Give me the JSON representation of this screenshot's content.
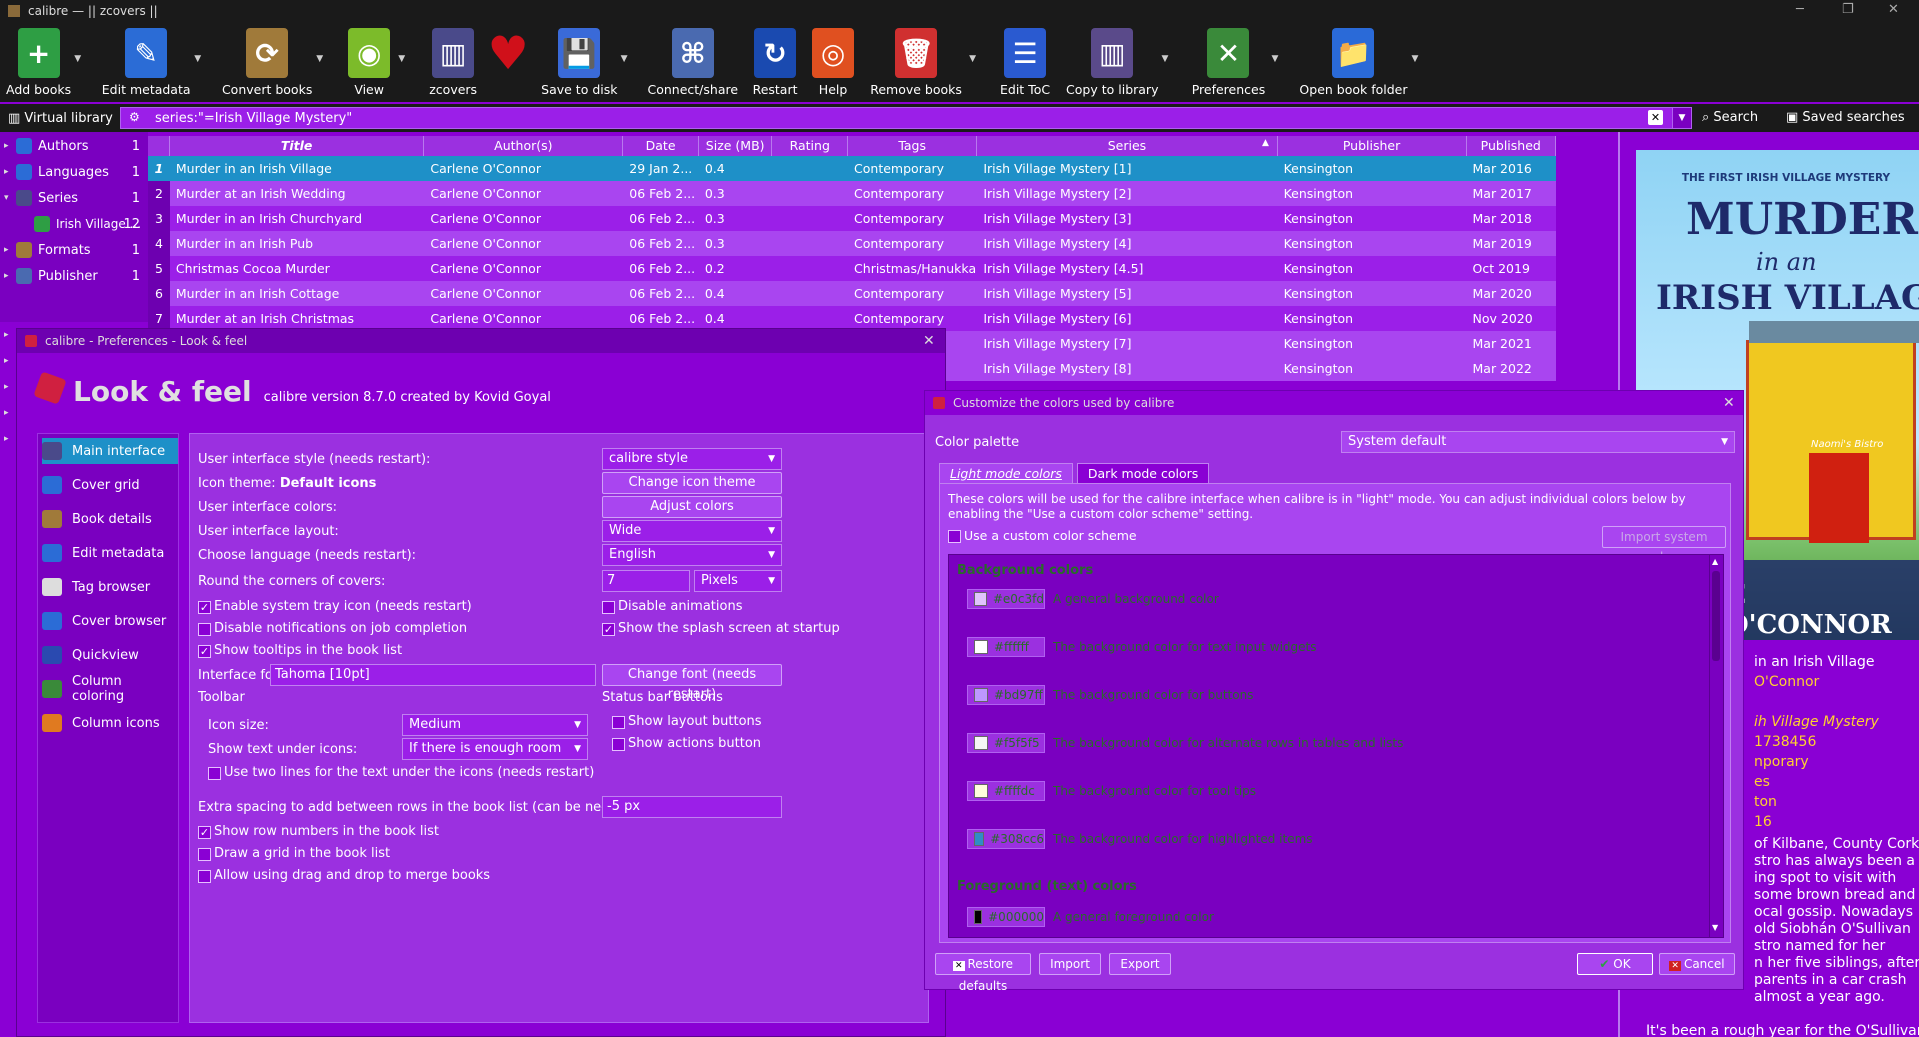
{
  "window": {
    "title": "calibre — || zcovers ||"
  },
  "toolbar": {
    "items": [
      {
        "label": "Add books",
        "icon": "add-books-icon",
        "color": "#2e9e44",
        "glyph": "+",
        "dd": true
      },
      {
        "label": "Edit metadata",
        "icon": "edit-metadata-icon",
        "color": "#2b6cd6",
        "glyph": "✎",
        "dd": true
      },
      {
        "label": "Convert books",
        "icon": "convert-books-icon",
        "color": "#a07a3a",
        "glyph": "⟳",
        "dd": true
      },
      {
        "label": "View",
        "icon": "view-icon",
        "color": "#7cbb2a",
        "glyph": "◉",
        "dd": true
      },
      {
        "label": "zcovers",
        "icon": "library-icon",
        "color": "#4a4a8a",
        "glyph": "▥",
        "dd": false
      },
      {
        "label": "",
        "icon": "heart-icon",
        "color": "#d0101a",
        "glyph": "♥",
        "dd": false
      },
      {
        "label": "Save to disk",
        "icon": "save-icon",
        "color": "#3a6ad8",
        "glyph": "💾",
        "dd": true
      },
      {
        "label": "Connect/share",
        "icon": "connect-share-icon",
        "color": "#4a6ab0",
        "glyph": "⌘",
        "dd": false
      },
      {
        "label": "Restart",
        "icon": "restart-icon",
        "color": "#1a4ab0",
        "glyph": "↻",
        "dd": false
      },
      {
        "label": "Help",
        "icon": "help-icon",
        "color": "#e05020",
        "glyph": "◎",
        "dd": false
      },
      {
        "label": "Remove books",
        "icon": "remove-books-icon",
        "color": "#d03030",
        "glyph": "🗑",
        "dd": true
      },
      {
        "label": "Edit ToC",
        "icon": "edit-toc-icon",
        "color": "#2a5ad0",
        "glyph": "☰",
        "dd": false
      },
      {
        "label": "Copy to library",
        "icon": "copy-library-icon",
        "color": "#5a4a8a",
        "glyph": "▥",
        "dd": true
      },
      {
        "label": "Preferences",
        "icon": "preferences-icon",
        "color": "#3a8a3a",
        "glyph": "✕",
        "dd": true
      },
      {
        "label": "Open book folder",
        "icon": "open-folder-icon",
        "color": "#2a6ad8",
        "glyph": "📁",
        "dd": true
      }
    ]
  },
  "search": {
    "virtual_library": "Virtual library",
    "query": "series:\"=Irish Village Mystery\"",
    "search_label": "Search",
    "saved_label": "Saved searches"
  },
  "tag_browser": {
    "items": [
      {
        "label": "Authors",
        "count": "1",
        "arrow": "▸",
        "icon": "authors-icon",
        "color": "#2b6cd6",
        "indent": false
      },
      {
        "label": "Languages",
        "count": "1",
        "arrow": "▸",
        "icon": "languages-icon",
        "color": "#2b6cd6",
        "indent": false
      },
      {
        "label": "Series",
        "count": "1",
        "arrow": "▾",
        "icon": "series-icon",
        "color": "#4a4a8a",
        "indent": false
      },
      {
        "label": "Irish Village ...",
        "count": "12",
        "arrow": "",
        "icon": "plus-icon",
        "color": "#2e9e44",
        "indent": true
      },
      {
        "label": "Formats",
        "count": "1",
        "arrow": "▸",
        "icon": "formats-icon",
        "color": "#a07a3a",
        "indent": false
      },
      {
        "label": "Publisher",
        "count": "1",
        "arrow": "▸",
        "icon": "publisher-icon",
        "color": "#4a6ab0",
        "indent": false
      }
    ]
  },
  "book_list": {
    "headers": [
      "",
      "Title",
      "Author(s)",
      "Date",
      "Size (MB)",
      "Rating",
      "Tags",
      "Series",
      "Publisher",
      "Published"
    ],
    "rows": [
      [
        "1",
        "Murder in an Irish Village",
        "Carlene O'Connor",
        "29 Jan 2...",
        "0.4",
        "",
        "Contemporary",
        "Irish Village Mystery [1]",
        "Kensington",
        "Mar 2016"
      ],
      [
        "2",
        "Murder at an Irish Wedding",
        "Carlene O'Connor",
        "06 Feb 2...",
        "0.3",
        "",
        "Contemporary",
        "Irish Village Mystery [2]",
        "Kensington",
        "Mar 2017"
      ],
      [
        "3",
        "Murder in an Irish Churchyard",
        "Carlene O'Connor",
        "06 Feb 2...",
        "0.3",
        "",
        "Contemporary",
        "Irish Village Mystery [3]",
        "Kensington",
        "Mar 2018"
      ],
      [
        "4",
        "Murder in an Irish Pub",
        "Carlene O'Connor",
        "06 Feb 2...",
        "0.3",
        "",
        "Contemporary",
        "Irish Village Mystery [4]",
        "Kensington",
        "Mar 2019"
      ],
      [
        "5",
        "Christmas Cocoa Murder",
        "Carlene O'Connor",
        "06 Feb 2...",
        "0.2",
        "",
        "Christmas/Hanukka...",
        "Irish Village Mystery [4.5]",
        "Kensington",
        "Oct 2019"
      ],
      [
        "6",
        "Murder in an Irish Cottage",
        "Carlene O'Connor",
        "06 Feb 2...",
        "0.4",
        "",
        "Contemporary",
        "Irish Village Mystery [5]",
        "Kensington",
        "Mar 2020"
      ],
      [
        "7",
        "Murder at an Irish Christmas",
        "Carlene O'Connor",
        "06 Feb 2...",
        "0.4",
        "",
        "Contemporary",
        "Irish Village Mystery [6]",
        "Kensington",
        "Nov 2020"
      ],
      [
        "8",
        "",
        "",
        "",
        "",
        "",
        "",
        "Irish Village Mystery [7]",
        "Kensington",
        "Mar 2021"
      ],
      [
        "9",
        "",
        "",
        "",
        "",
        "",
        "",
        "Irish Village Mystery [8]",
        "Kensington",
        "Mar 2022"
      ]
    ]
  },
  "cover": {
    "top_line": "THE FIRST IRISH VILLAGE MYSTERY",
    "title1": "MURDER",
    "title2": "in an",
    "title3": "IRISH VILLAGE",
    "author": "E O'CONNOR",
    "sign": "Naomi's Bistro"
  },
  "details": {
    "lines": [
      "in an Irish Village",
      "O'Connor",
      "",
      "ih Village Mystery",
      "1738456",
      "nporary",
      "es",
      "ton",
      "16"
    ],
    "desc": [
      "of Kilbane, County Cork,",
      "stro has always been a",
      "ing spot to visit with",
      "some brown bread and",
      "ocal gossip. Nowadays",
      "old Siobhán O'Sullivan",
      "stro named for her",
      "n her five siblings, after",
      "parents in a car crash",
      "almost a year ago.",
      "",
      "It's been a rough year for the O'Sullivans,"
    ]
  },
  "prefs": {
    "window_title": "calibre - Preferences - Look & feel",
    "header": "Look & feel",
    "version": "calibre version 8.7.0 created by Kovid Goyal",
    "nav": [
      {
        "label": "Main interface",
        "icon": "main-interface-icon",
        "color": "#4a4a8a"
      },
      {
        "label": "Cover grid",
        "icon": "cover-grid-icon",
        "color": "#2b6cd6"
      },
      {
        "label": "Book details",
        "icon": "book-details-icon",
        "color": "#a07a3a"
      },
      {
        "label": "Edit metadata",
        "icon": "edit-metadata-icon",
        "color": "#2b6cd6"
      },
      {
        "label": "Tag browser",
        "icon": "tag-browser-icon",
        "color": "#dddddd"
      },
      {
        "label": "Cover browser",
        "icon": "cover-browser-icon",
        "color": "#2b6cd6"
      },
      {
        "label": "Quickview",
        "icon": "quickview-icon",
        "color": "#2a4ab0"
      },
      {
        "label": "Column coloring",
        "icon": "column-coloring-icon",
        "color": "#3a8a3a"
      },
      {
        "label": "Column icons",
        "icon": "column-icons-icon",
        "color": "#e07a20"
      }
    ],
    "ui_style_label": "User interface style (needs restart):",
    "ui_style_value": "calibre style",
    "icon_theme_label": "Icon theme:",
    "icon_theme_value": "Default icons",
    "change_icon_theme": "Change icon theme",
    "ui_colors_label": "User interface colors:",
    "adjust_colors": "Adjust colors",
    "layout_label": "User interface layout:",
    "layout_value": "Wide",
    "language_label": "Choose language (needs restart):",
    "language_value": "English",
    "round_label": "Round the corners of covers:",
    "round_value": "7",
    "round_unit": "Pixels",
    "tray_label": "Enable system tray icon (needs restart)",
    "disable_anim_label": "Disable animations",
    "disable_notif_label": "Disable notifications on job completion",
    "splash_label": "Show the splash screen at startup",
    "tooltips_label": "Show tooltips in the book list",
    "font_label": "Interface font:",
    "font_value": "Tahoma [10pt]",
    "change_font": "Change font (needs restart)",
    "toolbar_group": "Toolbar",
    "statusbar_group": "Status bar buttons",
    "icon_size_label": "Icon size:",
    "icon_size_value": "Medium",
    "text_under_label": "Show text under icons:",
    "text_under_value": "If there is enough room",
    "two_lines_label": "Use two lines for the text under the icons (needs restart)",
    "show_layout_label": "Show layout buttons",
    "show_actions_label": "Show actions button",
    "spacing_label": "Extra spacing to add between rows in the book list (can be negative):",
    "spacing_value": "-5 px",
    "row_numbers_label": "Show row numbers in the book list",
    "grid_label": "Draw a grid in the book list",
    "drag_label": "Allow using drag and drop to merge books"
  },
  "colors_dialog": {
    "window_title": "Customize the colors used by calibre",
    "palette_label": "Color palette",
    "palette_value": "System default",
    "tab_light": "Light mode colors",
    "tab_dark": "Dark mode colors",
    "info": "These colors will be used for the calibre interface when calibre is in \"light\" mode. You can adjust individual colors below by enabling the \"Use a custom color scheme\" setting.",
    "custom_label": "Use a custom color scheme",
    "import_system": "Import system colors",
    "bg_section": "Background colors",
    "fg_section": "Foreground (text) colors",
    "bg_rows": [
      {
        "hex": "#e0c3fd",
        "desc": "A general background color"
      },
      {
        "hex": "#ffffff",
        "desc": "The background color for text input widgets"
      },
      {
        "hex": "#bd97ff",
        "desc": "The background color for buttons"
      },
      {
        "hex": "#f5f5f5",
        "desc": "The background color for alternate rows in tables and lists"
      },
      {
        "hex": "#ffffdc",
        "desc": "The background color for tool tips"
      },
      {
        "hex": "#308cc6",
        "desc": "The background color for highlighted items"
      }
    ],
    "fg_rows": [
      {
        "hex": "#000000",
        "desc": "A general foreground color"
      }
    ],
    "restore": "Restore defaults",
    "import": "Import",
    "export": "Export",
    "ok": "OK",
    "cancel": "Cancel"
  }
}
